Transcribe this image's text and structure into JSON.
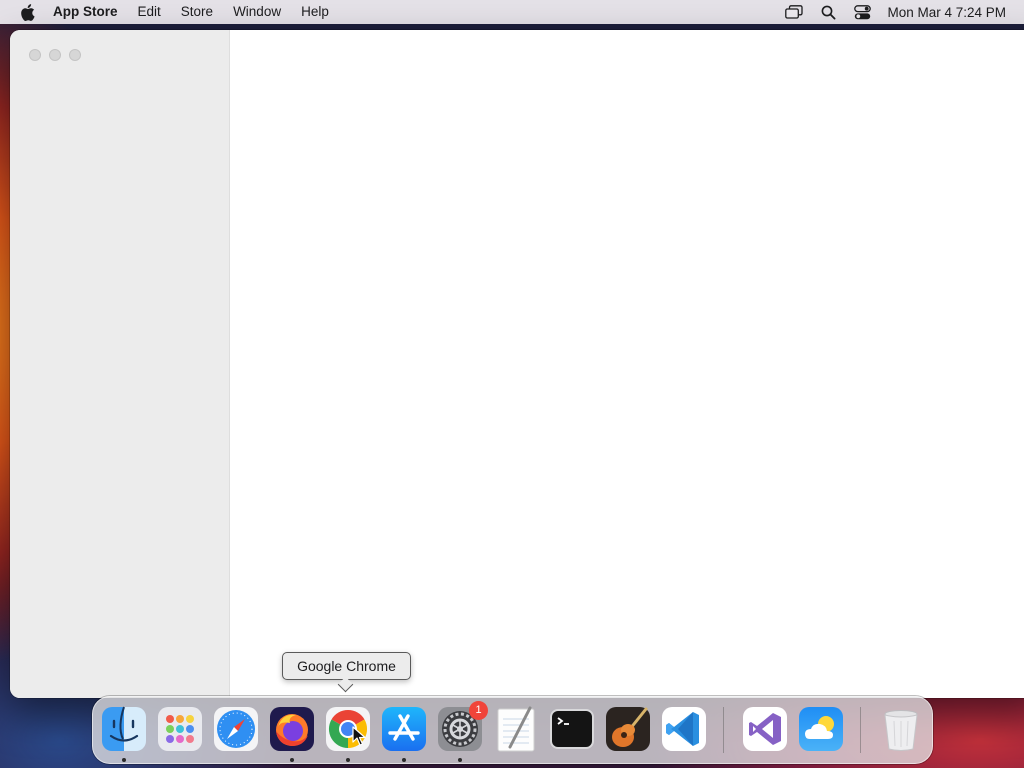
{
  "menubar": {
    "apple_icon": "apple-logo-icon",
    "app_name": "App Store",
    "items": [
      "Edit",
      "Store",
      "Window",
      "Help"
    ],
    "status_icons": [
      "screen-mirroring-icon",
      "spotlight-search-icon",
      "control-center-icon"
    ],
    "clock": "Mon Mar 4  7:24 PM"
  },
  "window": {
    "traffic_lights": [
      "close-button",
      "minimize-button",
      "zoom-button"
    ],
    "state": "inactive"
  },
  "tooltip": {
    "text": "Google Chrome"
  },
  "dock": {
    "apps": [
      {
        "name": "Finder",
        "icon": "finder-icon",
        "running": true
      },
      {
        "name": "Launchpad",
        "icon": "launchpad-icon",
        "running": false
      },
      {
        "name": "Safari",
        "icon": "safari-icon",
        "running": false
      },
      {
        "name": "Firefox",
        "icon": "firefox-icon",
        "running": true
      },
      {
        "name": "Google Chrome",
        "icon": "chrome-icon",
        "running": true
      },
      {
        "name": "App Store",
        "icon": "app-store-icon",
        "running": true
      },
      {
        "name": "System Settings",
        "icon": "system-settings-icon",
        "running": true,
        "badge": "1"
      },
      {
        "name": "TextEdit",
        "icon": "textedit-icon",
        "running": false
      },
      {
        "name": "Terminal",
        "icon": "terminal-icon",
        "running": false
      },
      {
        "name": "GarageBand",
        "icon": "garageband-icon",
        "running": false
      },
      {
        "name": "Visual Studio Code",
        "icon": "vscode-icon",
        "running": false
      }
    ],
    "recent_apps": [
      {
        "name": "Visual Studio",
        "icon": "visual-studio-icon",
        "running": false
      },
      {
        "name": "Weather",
        "icon": "weather-icon",
        "running": false
      }
    ],
    "trash": {
      "name": "Trash",
      "icon": "trash-icon"
    },
    "badge_color": "#f0443a"
  },
  "colors": {
    "menubar_bg": "#ece9ee",
    "sidebar_bg": "#ececec",
    "content_bg": "#ffffff"
  }
}
